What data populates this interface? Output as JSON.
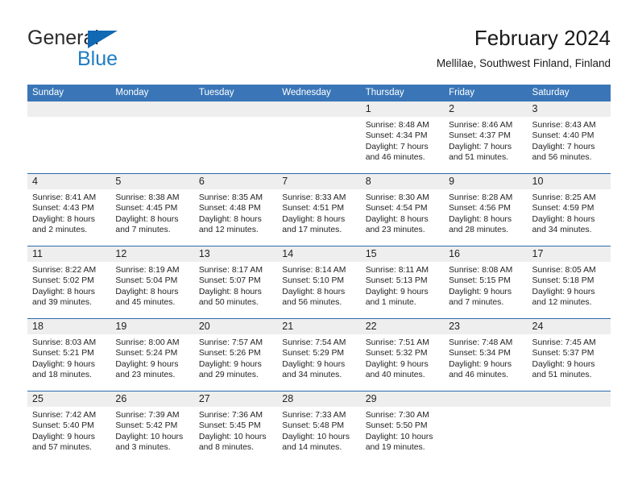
{
  "brand": {
    "name_top": "General",
    "name_bottom": "Blue",
    "triangle_color": "#1168b3",
    "blue_color": "#1f7cc4"
  },
  "header": {
    "title": "February 2024",
    "subtitle": "Mellilae, Southwest Finland, Finland"
  },
  "theme": {
    "header_blue": "#3a76b7",
    "separator_blue": "#2a6bb0",
    "daynum_band": "#eeeeee"
  },
  "weekday_headers": [
    "Sunday",
    "Monday",
    "Tuesday",
    "Wednesday",
    "Thursday",
    "Friday",
    "Saturday"
  ],
  "weeks": [
    [
      {
        "day": "",
        "sunrise": "",
        "sunset": "",
        "daylight_line1": "",
        "daylight_line2": ""
      },
      {
        "day": "",
        "sunrise": "",
        "sunset": "",
        "daylight_line1": "",
        "daylight_line2": ""
      },
      {
        "day": "",
        "sunrise": "",
        "sunset": "",
        "daylight_line1": "",
        "daylight_line2": ""
      },
      {
        "day": "",
        "sunrise": "",
        "sunset": "",
        "daylight_line1": "",
        "daylight_line2": ""
      },
      {
        "day": "1",
        "sunrise": "Sunrise: 8:48 AM",
        "sunset": "Sunset: 4:34 PM",
        "daylight_line1": "Daylight: 7 hours",
        "daylight_line2": "and 46 minutes."
      },
      {
        "day": "2",
        "sunrise": "Sunrise: 8:46 AM",
        "sunset": "Sunset: 4:37 PM",
        "daylight_line1": "Daylight: 7 hours",
        "daylight_line2": "and 51 minutes."
      },
      {
        "day": "3",
        "sunrise": "Sunrise: 8:43 AM",
        "sunset": "Sunset: 4:40 PM",
        "daylight_line1": "Daylight: 7 hours",
        "daylight_line2": "and 56 minutes."
      }
    ],
    [
      {
        "day": "4",
        "sunrise": "Sunrise: 8:41 AM",
        "sunset": "Sunset: 4:43 PM",
        "daylight_line1": "Daylight: 8 hours",
        "daylight_line2": "and 2 minutes."
      },
      {
        "day": "5",
        "sunrise": "Sunrise: 8:38 AM",
        "sunset": "Sunset: 4:45 PM",
        "daylight_line1": "Daylight: 8 hours",
        "daylight_line2": "and 7 minutes."
      },
      {
        "day": "6",
        "sunrise": "Sunrise: 8:35 AM",
        "sunset": "Sunset: 4:48 PM",
        "daylight_line1": "Daylight: 8 hours",
        "daylight_line2": "and 12 minutes."
      },
      {
        "day": "7",
        "sunrise": "Sunrise: 8:33 AM",
        "sunset": "Sunset: 4:51 PM",
        "daylight_line1": "Daylight: 8 hours",
        "daylight_line2": "and 17 minutes."
      },
      {
        "day": "8",
        "sunrise": "Sunrise: 8:30 AM",
        "sunset": "Sunset: 4:54 PM",
        "daylight_line1": "Daylight: 8 hours",
        "daylight_line2": "and 23 minutes."
      },
      {
        "day": "9",
        "sunrise": "Sunrise: 8:28 AM",
        "sunset": "Sunset: 4:56 PM",
        "daylight_line1": "Daylight: 8 hours",
        "daylight_line2": "and 28 minutes."
      },
      {
        "day": "10",
        "sunrise": "Sunrise: 8:25 AM",
        "sunset": "Sunset: 4:59 PM",
        "daylight_line1": "Daylight: 8 hours",
        "daylight_line2": "and 34 minutes."
      }
    ],
    [
      {
        "day": "11",
        "sunrise": "Sunrise: 8:22 AM",
        "sunset": "Sunset: 5:02 PM",
        "daylight_line1": "Daylight: 8 hours",
        "daylight_line2": "and 39 minutes."
      },
      {
        "day": "12",
        "sunrise": "Sunrise: 8:19 AM",
        "sunset": "Sunset: 5:04 PM",
        "daylight_line1": "Daylight: 8 hours",
        "daylight_line2": "and 45 minutes."
      },
      {
        "day": "13",
        "sunrise": "Sunrise: 8:17 AM",
        "sunset": "Sunset: 5:07 PM",
        "daylight_line1": "Daylight: 8 hours",
        "daylight_line2": "and 50 minutes."
      },
      {
        "day": "14",
        "sunrise": "Sunrise: 8:14 AM",
        "sunset": "Sunset: 5:10 PM",
        "daylight_line1": "Daylight: 8 hours",
        "daylight_line2": "and 56 minutes."
      },
      {
        "day": "15",
        "sunrise": "Sunrise: 8:11 AM",
        "sunset": "Sunset: 5:13 PM",
        "daylight_line1": "Daylight: 9 hours",
        "daylight_line2": "and 1 minute."
      },
      {
        "day": "16",
        "sunrise": "Sunrise: 8:08 AM",
        "sunset": "Sunset: 5:15 PM",
        "daylight_line1": "Daylight: 9 hours",
        "daylight_line2": "and 7 minutes."
      },
      {
        "day": "17",
        "sunrise": "Sunrise: 8:05 AM",
        "sunset": "Sunset: 5:18 PM",
        "daylight_line1": "Daylight: 9 hours",
        "daylight_line2": "and 12 minutes."
      }
    ],
    [
      {
        "day": "18",
        "sunrise": "Sunrise: 8:03 AM",
        "sunset": "Sunset: 5:21 PM",
        "daylight_line1": "Daylight: 9 hours",
        "daylight_line2": "and 18 minutes."
      },
      {
        "day": "19",
        "sunrise": "Sunrise: 8:00 AM",
        "sunset": "Sunset: 5:24 PM",
        "daylight_line1": "Daylight: 9 hours",
        "daylight_line2": "and 23 minutes."
      },
      {
        "day": "20",
        "sunrise": "Sunrise: 7:57 AM",
        "sunset": "Sunset: 5:26 PM",
        "daylight_line1": "Daylight: 9 hours",
        "daylight_line2": "and 29 minutes."
      },
      {
        "day": "21",
        "sunrise": "Sunrise: 7:54 AM",
        "sunset": "Sunset: 5:29 PM",
        "daylight_line1": "Daylight: 9 hours",
        "daylight_line2": "and 34 minutes."
      },
      {
        "day": "22",
        "sunrise": "Sunrise: 7:51 AM",
        "sunset": "Sunset: 5:32 PM",
        "daylight_line1": "Daylight: 9 hours",
        "daylight_line2": "and 40 minutes."
      },
      {
        "day": "23",
        "sunrise": "Sunrise: 7:48 AM",
        "sunset": "Sunset: 5:34 PM",
        "daylight_line1": "Daylight: 9 hours",
        "daylight_line2": "and 46 minutes."
      },
      {
        "day": "24",
        "sunrise": "Sunrise: 7:45 AM",
        "sunset": "Sunset: 5:37 PM",
        "daylight_line1": "Daylight: 9 hours",
        "daylight_line2": "and 51 minutes."
      }
    ],
    [
      {
        "day": "25",
        "sunrise": "Sunrise: 7:42 AM",
        "sunset": "Sunset: 5:40 PM",
        "daylight_line1": "Daylight: 9 hours",
        "daylight_line2": "and 57 minutes."
      },
      {
        "day": "26",
        "sunrise": "Sunrise: 7:39 AM",
        "sunset": "Sunset: 5:42 PM",
        "daylight_line1": "Daylight: 10 hours",
        "daylight_line2": "and 3 minutes."
      },
      {
        "day": "27",
        "sunrise": "Sunrise: 7:36 AM",
        "sunset": "Sunset: 5:45 PM",
        "daylight_line1": "Daylight: 10 hours",
        "daylight_line2": "and 8 minutes."
      },
      {
        "day": "28",
        "sunrise": "Sunrise: 7:33 AM",
        "sunset": "Sunset: 5:48 PM",
        "daylight_line1": "Daylight: 10 hours",
        "daylight_line2": "and 14 minutes."
      },
      {
        "day": "29",
        "sunrise": "Sunrise: 7:30 AM",
        "sunset": "Sunset: 5:50 PM",
        "daylight_line1": "Daylight: 10 hours",
        "daylight_line2": "and 19 minutes."
      },
      {
        "day": "",
        "sunrise": "",
        "sunset": "",
        "daylight_line1": "",
        "daylight_line2": ""
      },
      {
        "day": "",
        "sunrise": "",
        "sunset": "",
        "daylight_line1": "",
        "daylight_line2": ""
      }
    ]
  ]
}
